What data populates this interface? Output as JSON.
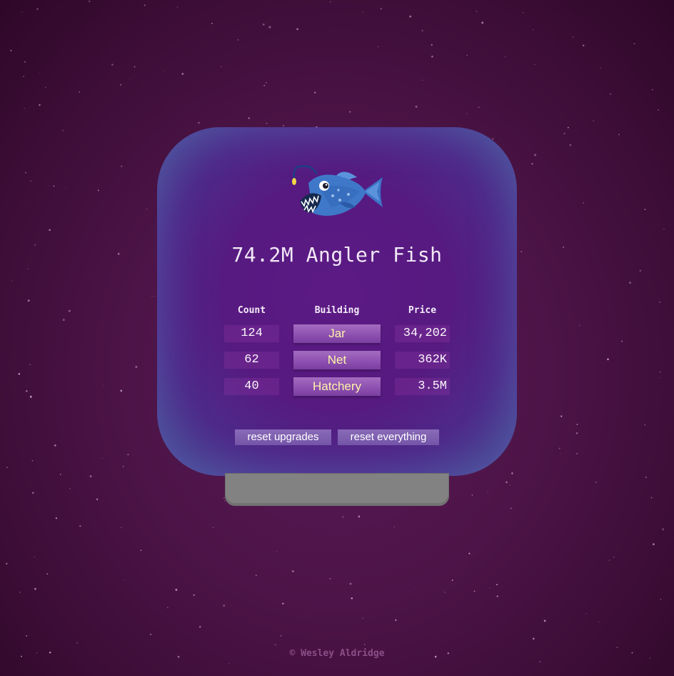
{
  "title": "74.2M Angler Fish",
  "table": {
    "headers": {
      "count": "Count",
      "building": "Building",
      "price": "Price"
    },
    "rows": [
      {
        "count": "124",
        "building": "Jar",
        "price": "34,202"
      },
      {
        "count": "62",
        "building": "Net",
        "price": "362K"
      },
      {
        "count": "40",
        "building": "Hatchery",
        "price": "3.5M"
      }
    ]
  },
  "buttons": {
    "reset_upgrades": "reset upgrades",
    "reset_everything": "reset everything"
  },
  "footer": "© Wesley Aldridge",
  "colors": {
    "background": "#4c1447",
    "tank": "#561a80",
    "tank_edge": "#4a4a95",
    "building_text": "#fff4a8",
    "stand": "#828282"
  },
  "icons": {
    "fish": "angler-fish-icon"
  }
}
